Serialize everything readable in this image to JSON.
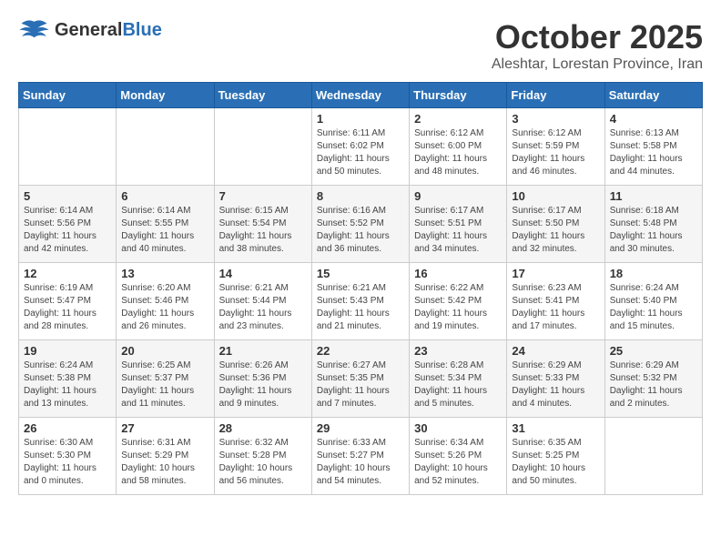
{
  "header": {
    "logo_general": "General",
    "logo_blue": "Blue",
    "month": "October 2025",
    "location": "Aleshtar, Lorestan Province, Iran"
  },
  "weekdays": [
    "Sunday",
    "Monday",
    "Tuesday",
    "Wednesday",
    "Thursday",
    "Friday",
    "Saturday"
  ],
  "weeks": [
    [
      {
        "day": "",
        "info": ""
      },
      {
        "day": "",
        "info": ""
      },
      {
        "day": "",
        "info": ""
      },
      {
        "day": "1",
        "info": "Sunrise: 6:11 AM\nSunset: 6:02 PM\nDaylight: 11 hours and 50 minutes."
      },
      {
        "day": "2",
        "info": "Sunrise: 6:12 AM\nSunset: 6:00 PM\nDaylight: 11 hours and 48 minutes."
      },
      {
        "day": "3",
        "info": "Sunrise: 6:12 AM\nSunset: 5:59 PM\nDaylight: 11 hours and 46 minutes."
      },
      {
        "day": "4",
        "info": "Sunrise: 6:13 AM\nSunset: 5:58 PM\nDaylight: 11 hours and 44 minutes."
      }
    ],
    [
      {
        "day": "5",
        "info": "Sunrise: 6:14 AM\nSunset: 5:56 PM\nDaylight: 11 hours and 42 minutes."
      },
      {
        "day": "6",
        "info": "Sunrise: 6:14 AM\nSunset: 5:55 PM\nDaylight: 11 hours and 40 minutes."
      },
      {
        "day": "7",
        "info": "Sunrise: 6:15 AM\nSunset: 5:54 PM\nDaylight: 11 hours and 38 minutes."
      },
      {
        "day": "8",
        "info": "Sunrise: 6:16 AM\nSunset: 5:52 PM\nDaylight: 11 hours and 36 minutes."
      },
      {
        "day": "9",
        "info": "Sunrise: 6:17 AM\nSunset: 5:51 PM\nDaylight: 11 hours and 34 minutes."
      },
      {
        "day": "10",
        "info": "Sunrise: 6:17 AM\nSunset: 5:50 PM\nDaylight: 11 hours and 32 minutes."
      },
      {
        "day": "11",
        "info": "Sunrise: 6:18 AM\nSunset: 5:48 PM\nDaylight: 11 hours and 30 minutes."
      }
    ],
    [
      {
        "day": "12",
        "info": "Sunrise: 6:19 AM\nSunset: 5:47 PM\nDaylight: 11 hours and 28 minutes."
      },
      {
        "day": "13",
        "info": "Sunrise: 6:20 AM\nSunset: 5:46 PM\nDaylight: 11 hours and 26 minutes."
      },
      {
        "day": "14",
        "info": "Sunrise: 6:21 AM\nSunset: 5:44 PM\nDaylight: 11 hours and 23 minutes."
      },
      {
        "day": "15",
        "info": "Sunrise: 6:21 AM\nSunset: 5:43 PM\nDaylight: 11 hours and 21 minutes."
      },
      {
        "day": "16",
        "info": "Sunrise: 6:22 AM\nSunset: 5:42 PM\nDaylight: 11 hours and 19 minutes."
      },
      {
        "day": "17",
        "info": "Sunrise: 6:23 AM\nSunset: 5:41 PM\nDaylight: 11 hours and 17 minutes."
      },
      {
        "day": "18",
        "info": "Sunrise: 6:24 AM\nSunset: 5:40 PM\nDaylight: 11 hours and 15 minutes."
      }
    ],
    [
      {
        "day": "19",
        "info": "Sunrise: 6:24 AM\nSunset: 5:38 PM\nDaylight: 11 hours and 13 minutes."
      },
      {
        "day": "20",
        "info": "Sunrise: 6:25 AM\nSunset: 5:37 PM\nDaylight: 11 hours and 11 minutes."
      },
      {
        "day": "21",
        "info": "Sunrise: 6:26 AM\nSunset: 5:36 PM\nDaylight: 11 hours and 9 minutes."
      },
      {
        "day": "22",
        "info": "Sunrise: 6:27 AM\nSunset: 5:35 PM\nDaylight: 11 hours and 7 minutes."
      },
      {
        "day": "23",
        "info": "Sunrise: 6:28 AM\nSunset: 5:34 PM\nDaylight: 11 hours and 5 minutes."
      },
      {
        "day": "24",
        "info": "Sunrise: 6:29 AM\nSunset: 5:33 PM\nDaylight: 11 hours and 4 minutes."
      },
      {
        "day": "25",
        "info": "Sunrise: 6:29 AM\nSunset: 5:32 PM\nDaylight: 11 hours and 2 minutes."
      }
    ],
    [
      {
        "day": "26",
        "info": "Sunrise: 6:30 AM\nSunset: 5:30 PM\nDaylight: 11 hours and 0 minutes."
      },
      {
        "day": "27",
        "info": "Sunrise: 6:31 AM\nSunset: 5:29 PM\nDaylight: 10 hours and 58 minutes."
      },
      {
        "day": "28",
        "info": "Sunrise: 6:32 AM\nSunset: 5:28 PM\nDaylight: 10 hours and 56 minutes."
      },
      {
        "day": "29",
        "info": "Sunrise: 6:33 AM\nSunset: 5:27 PM\nDaylight: 10 hours and 54 minutes."
      },
      {
        "day": "30",
        "info": "Sunrise: 6:34 AM\nSunset: 5:26 PM\nDaylight: 10 hours and 52 minutes."
      },
      {
        "day": "31",
        "info": "Sunrise: 6:35 AM\nSunset: 5:25 PM\nDaylight: 10 hours and 50 minutes."
      },
      {
        "day": "",
        "info": ""
      }
    ]
  ]
}
